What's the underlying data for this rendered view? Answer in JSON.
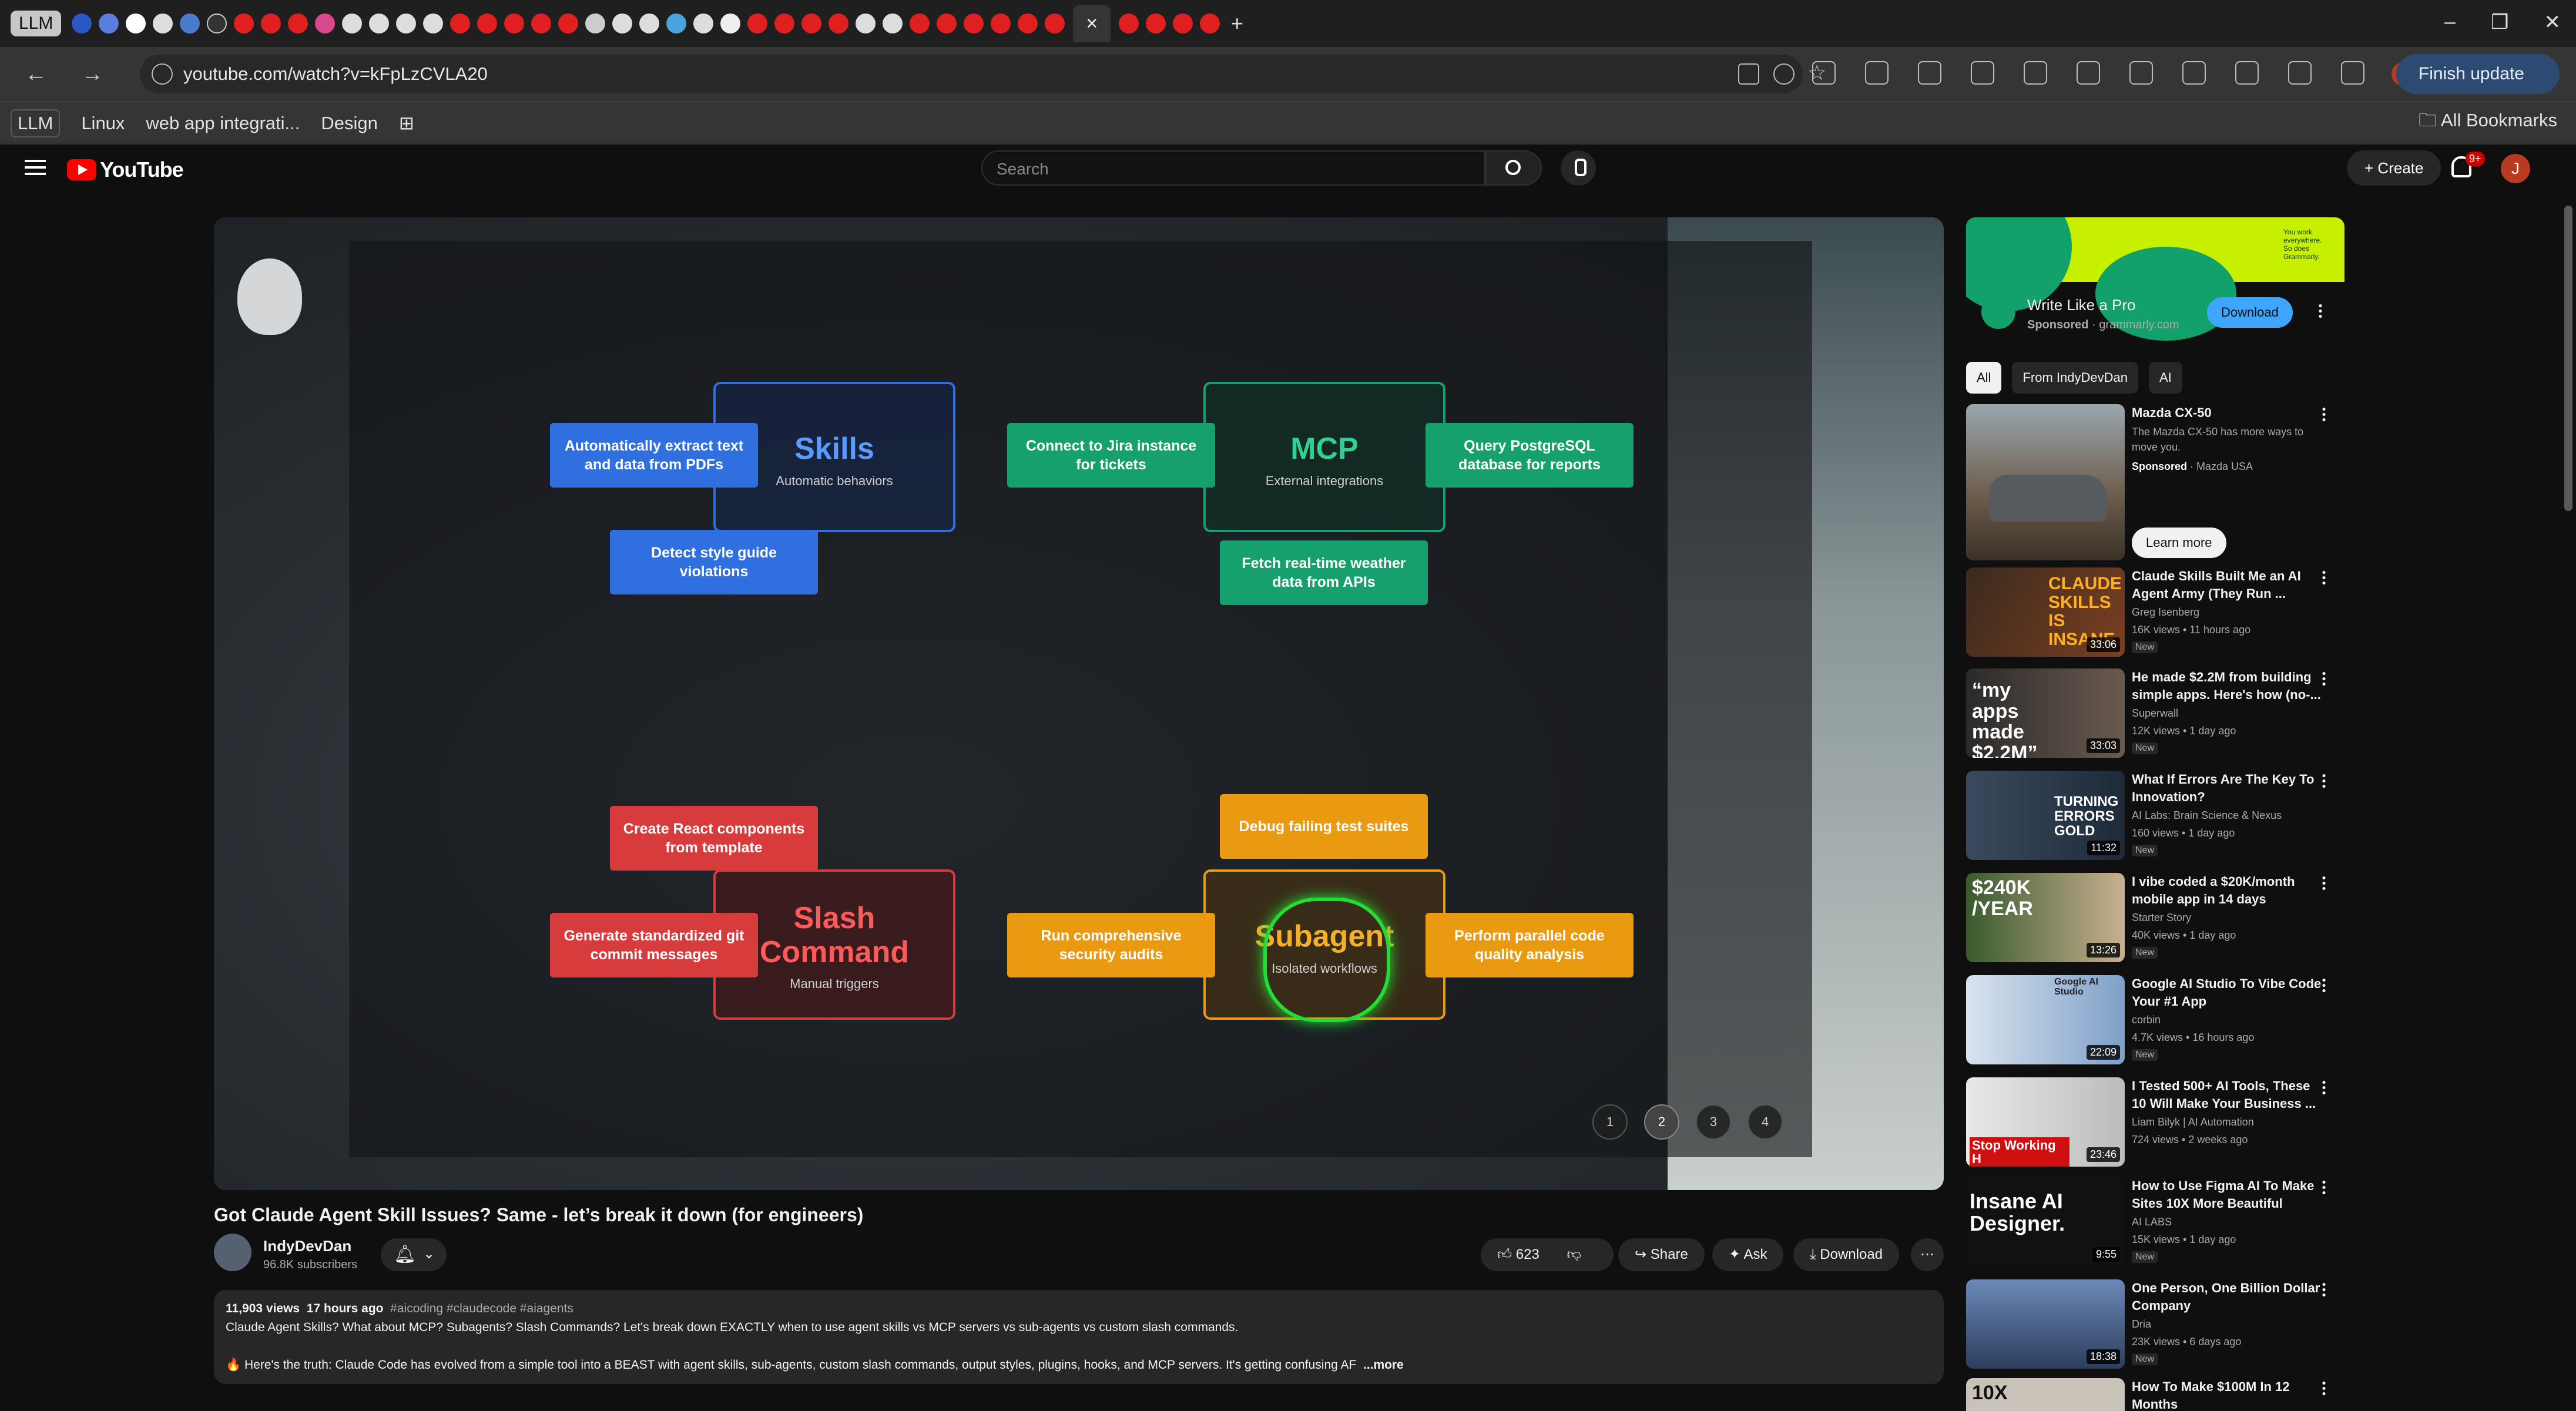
{
  "browser": {
    "tab_group": "LLM",
    "url": "youtube.com/watch?v=kFpLzCVLA20",
    "finish_update": "Finish update",
    "profile_letter": "J",
    "bookmarks": [
      "LLM",
      "Linux",
      "web app integrati...",
      "Design"
    ],
    "all_bookmarks": "All Bookmarks",
    "close_tab": "×",
    "new_tab": "+"
  },
  "youtube": {
    "logo_text": "YouTube",
    "search_placeholder": "Search",
    "create_label": "Create",
    "notif_badge": "9+",
    "avatar_letter": "J"
  },
  "video_overlay": {
    "skills": {
      "title": "Skills",
      "sub": "Automatic behaviors",
      "chips": [
        "Automatically extract text and data from PDFs",
        "Detect style guide violations"
      ]
    },
    "mcp": {
      "title": "MCP",
      "sub": "External integrations",
      "chips": [
        "Connect to Jira instance for tickets",
        "Query PostgreSQL database for reports",
        "Fetch real-time weather data from APIs"
      ]
    },
    "slash": {
      "title": "Slash Command",
      "sub": "Manual triggers",
      "chips": [
        "Create React components from template",
        "Generate standardized git commit messages"
      ]
    },
    "subagent": {
      "title": "Subagent",
      "sub": "Isolated workflows",
      "chips": [
        "Debug failing test suites",
        "Run comprehensive security audits",
        "Perform parallel code quality analysis"
      ]
    },
    "pages": [
      "1",
      "2",
      "3",
      "4"
    ],
    "active_page": "2"
  },
  "video": {
    "title": "Got Claude Agent Skill Issues? Same - let’s break it down (for engineers)",
    "channel": "IndyDevDan",
    "subscribers": "96.8K subscribers",
    "likes": "623",
    "share": "Share",
    "ask": "Ask",
    "download": "Download",
    "views": "11,903 views",
    "age": "17 hours ago",
    "tags": "#aicoding #claudecode #aiagents",
    "desc_line1": "Claude Agent Skills? What about MCP? Subagents? Slash Commands?  Let's break down EXACTLY when to use agent skills vs MCP servers vs sub-agents vs custom slash commands.",
    "desc_line2": "🔥 Here's the truth: Claude Code has evolved from a simple tool into a BEAST with agent skills, sub-agents, custom slash commands, output styles, plugins, hooks, and MCP servers. It's getting confusing AF",
    "more": "...more"
  },
  "ad": {
    "banner_text": "You work everywhere. So does Grammarly.",
    "title": "Write Like a Pro",
    "sponsored": "Sponsored",
    "domain": "grammarly.com",
    "button": "Download"
  },
  "filters": [
    "All",
    "From IndyDevDan",
    "AI"
  ],
  "recommendations": [
    {
      "title": "Mazda CX-50",
      "channel": "Mazda USA",
      "desc": "The Mazda CX-50 has more ways to move you.",
      "sponsored": "Sponsored",
      "cta": "Learn more"
    },
    {
      "title": "Claude Skills Built Me an AI Agent Army (They Run ...",
      "channel": "Greg Isenberg",
      "meta": "16K views • 11 hours ago",
      "badge": "New",
      "duration": "33:06",
      "thumb_text": "CLAUDE SKILLS IS INSANE"
    },
    {
      "title": "He made $2.2M from building simple apps. Here's how (no-...",
      "channel": "Superwall",
      "meta": "12K views • 1 day ago",
      "badge": "New",
      "duration": "33:03",
      "thumb_text": "“my apps made $2.2M”"
    },
    {
      "title": "What If Errors Are The Key To Innovation?",
      "channel": "AI Labs: Brain Science & Nexus",
      "meta": "160 views • 1 day ago",
      "badge": "New",
      "duration": "11:32",
      "thumb_text": "TURNING ERRORS GOLD"
    },
    {
      "title": "I vibe coded a $20K/month mobile app in 14 days",
      "channel": "Starter Story",
      "meta": "40K views • 1 day ago",
      "badge": "New",
      "duration": "13:26",
      "thumb_text": "$240K /YEAR"
    },
    {
      "title": "Google AI Studio To Vibe Code Your #1 App",
      "channel": "corbin",
      "meta": "4.7K views • 16 hours ago",
      "badge": "New",
      "duration": "22:09",
      "thumb_text": "Google AI Studio"
    },
    {
      "title": "I Tested 500+ AI Tools, These 10 Will Make Your Business ...",
      "channel": "Liam Bilyk | AI Automation",
      "meta": "724 views • 2 weeks ago",
      "badge": "",
      "duration": "23:46",
      "thumb_text": "Stop Working H"
    },
    {
      "title": "How to Use Figma AI To Make Sites 10X More Beautiful",
      "channel": "AI LABS",
      "meta": "15K views • 1 day ago",
      "badge": "New",
      "duration": "9:55",
      "thumb_text": "Insane AI Designer."
    },
    {
      "title": "One Person, One Billion Dollar Company",
      "channel": "Dria",
      "meta": "23K views • 6 days ago",
      "badge": "New",
      "duration": "18:38",
      "thumb_text": ""
    },
    {
      "title": "How To Make $100M In 12 Months",
      "channel": "",
      "meta": "",
      "badge": "",
      "duration": "",
      "thumb_text": "10X"
    }
  ]
}
